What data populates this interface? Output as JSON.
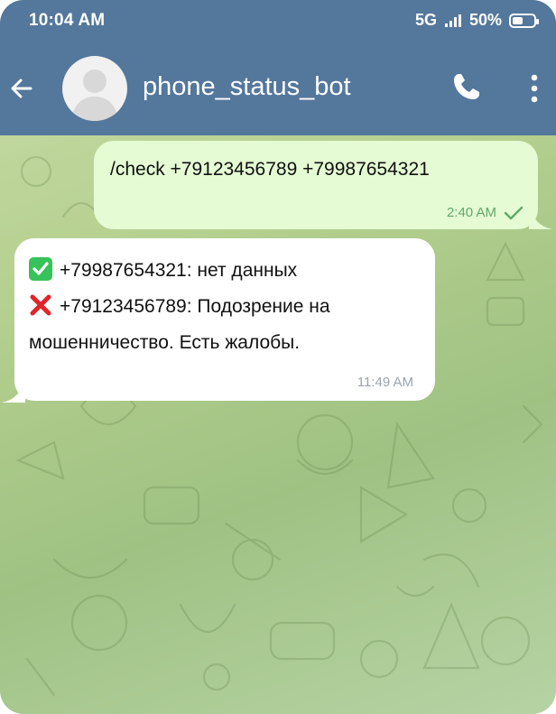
{
  "status_bar": {
    "time": "10:04 AM",
    "network": "5G",
    "battery": "50%",
    "battery_level": 0.5
  },
  "header": {
    "title": "phone_status_bot",
    "icons": [
      "back-arrow-icon",
      "avatar-placeholder-icon",
      "phone-icon",
      "more-vertical-icon"
    ]
  },
  "messages": [
    {
      "direction": "outgoing",
      "text": "/check +79123456789 +79987654321",
      "time": "2:40 AM",
      "read_mark": "check-icon"
    },
    {
      "direction": "incoming",
      "lines": [
        {
          "icon": "check-emoji-icon",
          "text": "+79987654321: нет данных"
        },
        {
          "icon": "cross-emoji-icon",
          "text": "+79123456789: Подозрение на мошенничество. Есть жалобы."
        }
      ],
      "time": "11:49 AM"
    }
  ],
  "colors": {
    "header": "#54779c",
    "outgoing_bubble": "#e4fbd3",
    "incoming_bubble": "#ffffff",
    "outgoing_meta": "#63a86a",
    "incoming_meta": "#9aa3ad"
  }
}
